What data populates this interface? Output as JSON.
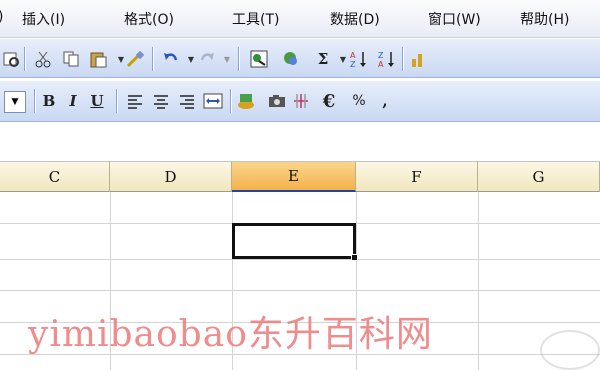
{
  "menu": {
    "items": [
      "插入(I)",
      "格式(O)",
      "工具(T)",
      "数据(D)",
      "窗口(W)",
      "帮助(H)"
    ]
  },
  "toolbar_standard": {
    "buttons": [
      "preview-icon",
      "cut-icon",
      "copy-icon",
      "paste-icon",
      "format-painter-icon",
      "undo-icon",
      "redo-icon",
      "hyperlink-icon",
      "research-icon",
      "autosum-icon",
      "sort-ascending-icon",
      "sort-descending-icon",
      "chart-icon"
    ],
    "autosum_symbol": "Σ"
  },
  "toolbar_format": {
    "bold": "B",
    "italic": "I",
    "underline": "U",
    "currency": "€",
    "percent": "%",
    "comma": ","
  },
  "columns": [
    "C",
    "D",
    "E",
    "F",
    "G"
  ],
  "active_column": "E",
  "watermark": {
    "text": "yimibaobao东升百科网"
  },
  "colors": {
    "menu_bg": "#eef0f8",
    "toolbar_bg": "#d6e2f7",
    "header_bg": "#f3ead0",
    "active_header": "#f5b450",
    "watermark": "#ec7878"
  }
}
